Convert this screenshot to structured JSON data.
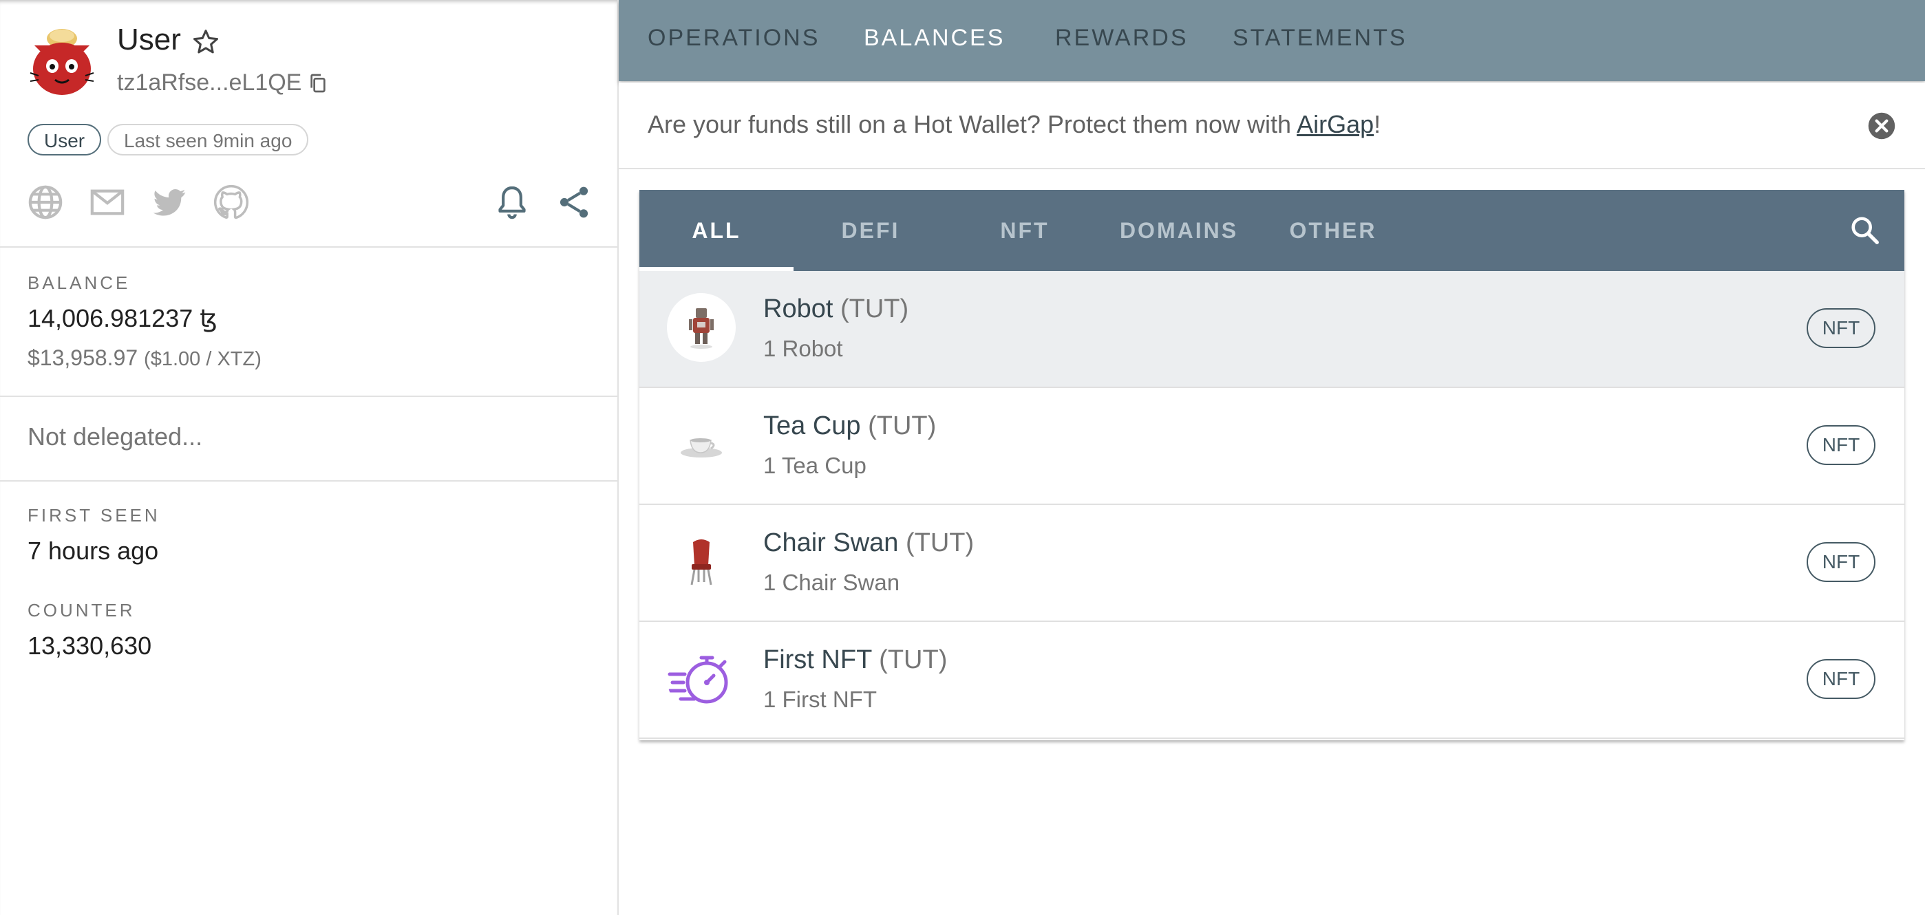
{
  "account": {
    "name": "User",
    "address": "tz1aRfse...eL1QE",
    "chips": {
      "type": "User",
      "last_seen": "Last seen 9min ago"
    }
  },
  "icons": [
    "globe-icon",
    "mail-icon",
    "twitter-icon",
    "github-icon",
    "bell-icon",
    "share-icon",
    "star-icon",
    "copy-icon",
    "close-icon",
    "search-icon"
  ],
  "balance": {
    "label": "BALANCE",
    "amount": "14,006.981237 ꜩ",
    "usd": "$13,958.97",
    "rate": "($1.00 / XTZ)"
  },
  "delegation": "Not delegated...",
  "first_seen": {
    "label": "FIRST SEEN",
    "value": "7 hours ago"
  },
  "counter": {
    "label": "COUNTER",
    "value": "13,330,630"
  },
  "main_tabs": [
    "OPERATIONS",
    "BALANCES",
    "REWARDS",
    "STATEMENTS"
  ],
  "active_main_tab": "BALANCES",
  "banner": {
    "text": "Are your funds still on a Hot Wallet? Protect them now with ",
    "link": "AirGap",
    "suffix": "!"
  },
  "category_tabs": [
    "ALL",
    "DEFI",
    "NFT",
    "DOMAINS",
    "OTHER"
  ],
  "active_category_tab": "ALL",
  "tokens": [
    {
      "name": "Robot",
      "symbol": "(TUT)",
      "amount": "1 Robot",
      "badge": "NFT"
    },
    {
      "name": "Tea Cup",
      "symbol": "(TUT)",
      "amount": "1 Tea Cup",
      "badge": "NFT"
    },
    {
      "name": "Chair Swan",
      "symbol": "(TUT)",
      "amount": "1 Chair Swan",
      "badge": "NFT"
    },
    {
      "name": "First NFT",
      "symbol": "(TUT)",
      "amount": "1 First NFT",
      "badge": "NFT"
    }
  ],
  "colors": {
    "header_bar": "#78909c",
    "category_bar": "#5a7082",
    "first_nft_icon": "#9c5ee0"
  }
}
